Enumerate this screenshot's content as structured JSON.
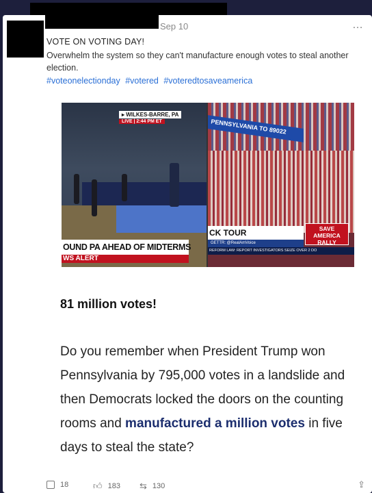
{
  "post": {
    "date": "Sep 10",
    "more": "…",
    "title": "VOTE ON VOTING DAY!",
    "body": "Overwhelm the system so they can't manufacture enough votes to steal another election.",
    "hashtags": [
      "#voteonelectionday",
      "#votered",
      "#voteredtosaveamerica"
    ]
  },
  "image": {
    "location_tag": "▸ WILKES-BARRE, PA",
    "live_tag": "LIVE  |  2:44 PM ET",
    "chyron_left": "OUND PA AHEAD OF MIDTERMS",
    "alert_left": "WS ALERT",
    "banner": "PENNSYLVANIA TO 89022",
    "chyron_right": "CK TOUR",
    "gettr": "GETTR: @RealAmVoice",
    "ticker": "REFORM LAW: REPORT     INVESTIGATORS SEIZE OVER 2 DO",
    "rally_logo": [
      "SAVE",
      "AMERICA",
      "RALLY"
    ]
  },
  "article": {
    "big_count": "81 million votes!",
    "quote_part1": "Do you remember when President Trump won Pennsylvania by 795,000 votes in a landslide and then Democrats locked the doors on the counting rooms and ",
    "quote_highlight": "manufactured a million votes",
    "quote_part2": " in five days to steal the state?"
  },
  "actions": {
    "comments": "18",
    "likes": "183",
    "reposts": "130",
    "comment_icon": "comment-icon",
    "like_icon": "thumbs-up-icon",
    "repost_icon": "repost-icon",
    "share_icon": "share-icon"
  }
}
